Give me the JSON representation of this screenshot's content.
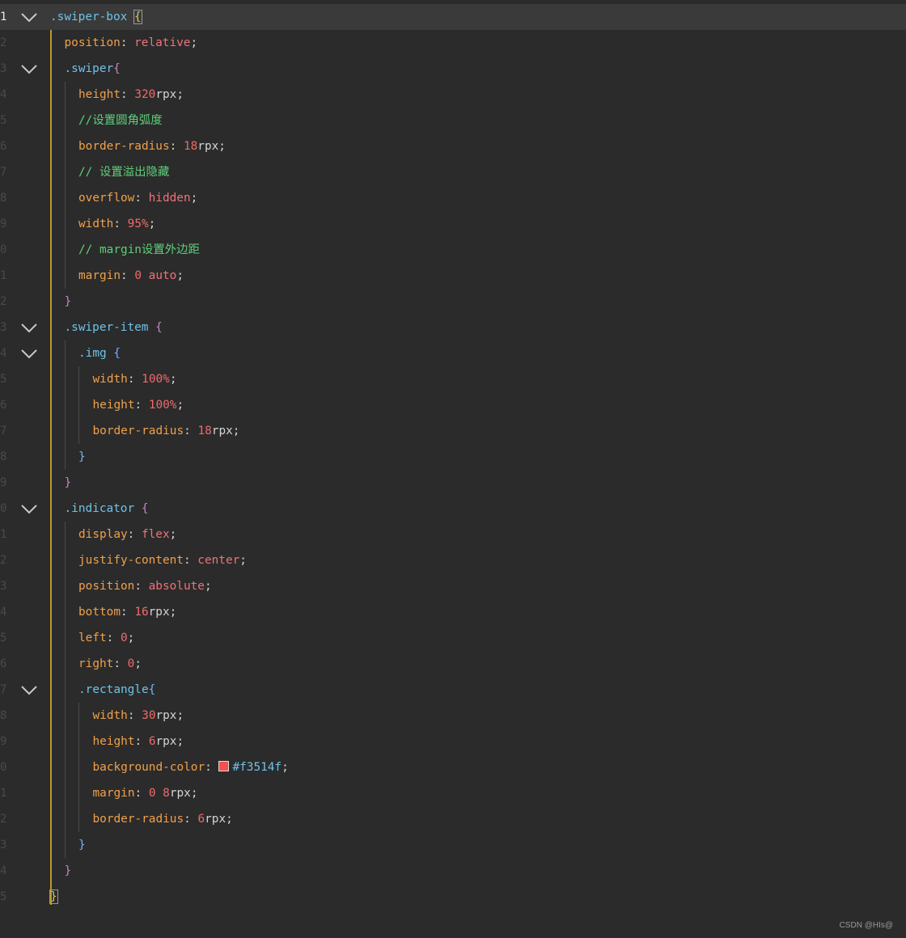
{
  "editor": {
    "colors": {
      "background": "#2b2b2b",
      "current_line": "#3a3a3a",
      "selector": "#6fc3e8",
      "property": "#f0a04b",
      "value": "#f0727a",
      "comment": "#5fce7a"
    },
    "lines": [
      {
        "num": "1",
        "fold": true,
        "current": true,
        "indent": 0,
        "tokens": [
          {
            "t": ".swiper-box",
            "c": "sel"
          },
          {
            "t": " ",
            "c": "punc"
          },
          {
            "t": "{",
            "c": "brace-y brace-box"
          }
        ]
      },
      {
        "num": "2",
        "fold": false,
        "indent": 1,
        "tokens": [
          {
            "t": "position",
            "c": "prop"
          },
          {
            "t": ": ",
            "c": "punc"
          },
          {
            "t": "relative",
            "c": "val"
          },
          {
            "t": ";",
            "c": "punc"
          }
        ]
      },
      {
        "num": "3",
        "fold": true,
        "indent": 1,
        "tokens": [
          {
            "t": ".swiper",
            "c": "sel"
          },
          {
            "t": "{",
            "c": "brace-p"
          }
        ]
      },
      {
        "num": "4",
        "fold": false,
        "indent": 2,
        "tokens": [
          {
            "t": "height",
            "c": "prop"
          },
          {
            "t": ": ",
            "c": "punc"
          },
          {
            "t": "320",
            "c": "num"
          },
          {
            "t": "rpx",
            "c": "unit"
          },
          {
            "t": ";",
            "c": "punc"
          }
        ]
      },
      {
        "num": "5",
        "fold": false,
        "indent": 2,
        "tokens": [
          {
            "t": "//设置圆角弧度",
            "c": "comment"
          }
        ]
      },
      {
        "num": "6",
        "fold": false,
        "indent": 2,
        "tokens": [
          {
            "t": "border-radius",
            "c": "prop"
          },
          {
            "t": ": ",
            "c": "punc"
          },
          {
            "t": "18",
            "c": "num"
          },
          {
            "t": "rpx",
            "c": "unit"
          },
          {
            "t": ";",
            "c": "punc"
          }
        ]
      },
      {
        "num": "7",
        "fold": false,
        "indent": 2,
        "tokens": [
          {
            "t": "// 设置溢出隐藏",
            "c": "comment"
          }
        ]
      },
      {
        "num": "8",
        "fold": false,
        "indent": 2,
        "tokens": [
          {
            "t": "overflow",
            "c": "prop"
          },
          {
            "t": ": ",
            "c": "punc"
          },
          {
            "t": "hidden",
            "c": "val"
          },
          {
            "t": ";",
            "c": "punc"
          }
        ]
      },
      {
        "num": "9",
        "fold": false,
        "indent": 2,
        "tokens": [
          {
            "t": "width",
            "c": "prop"
          },
          {
            "t": ": ",
            "c": "punc"
          },
          {
            "t": "95%",
            "c": "num"
          },
          {
            "t": ";",
            "c": "punc"
          }
        ]
      },
      {
        "num": "0",
        "fold": false,
        "indent": 2,
        "tokens": [
          {
            "t": "// margin设置外边距",
            "c": "comment"
          }
        ]
      },
      {
        "num": "1",
        "fold": false,
        "indent": 2,
        "tokens": [
          {
            "t": "margin",
            "c": "prop"
          },
          {
            "t": ": ",
            "c": "punc"
          },
          {
            "t": "0",
            "c": "num"
          },
          {
            "t": " ",
            "c": "punc"
          },
          {
            "t": "auto",
            "c": "val"
          },
          {
            "t": ";",
            "c": "punc"
          }
        ]
      },
      {
        "num": "2",
        "fold": false,
        "indent": 1,
        "tokens": [
          {
            "t": "}",
            "c": "brace-p"
          }
        ]
      },
      {
        "num": "3",
        "fold": true,
        "indent": 1,
        "tokens": [
          {
            "t": ".swiper-item",
            "c": "sel"
          },
          {
            "t": " ",
            "c": "punc"
          },
          {
            "t": "{",
            "c": "brace-p"
          }
        ]
      },
      {
        "num": "4",
        "fold": true,
        "indent": 2,
        "tokens": [
          {
            "t": ".img",
            "c": "sel"
          },
          {
            "t": " ",
            "c": "punc"
          },
          {
            "t": "{",
            "c": "brace-b"
          }
        ]
      },
      {
        "num": "5",
        "fold": false,
        "indent": 3,
        "tokens": [
          {
            "t": "width",
            "c": "prop"
          },
          {
            "t": ": ",
            "c": "punc"
          },
          {
            "t": "100%",
            "c": "num"
          },
          {
            "t": ";",
            "c": "punc"
          }
        ]
      },
      {
        "num": "6",
        "fold": false,
        "indent": 3,
        "tokens": [
          {
            "t": "height",
            "c": "prop"
          },
          {
            "t": ": ",
            "c": "punc"
          },
          {
            "t": "100%",
            "c": "num"
          },
          {
            "t": ";",
            "c": "punc"
          }
        ]
      },
      {
        "num": "7",
        "fold": false,
        "indent": 3,
        "tokens": [
          {
            "t": "border-radius",
            "c": "prop"
          },
          {
            "t": ": ",
            "c": "punc"
          },
          {
            "t": "18",
            "c": "num"
          },
          {
            "t": "rpx",
            "c": "unit"
          },
          {
            "t": ";",
            "c": "punc"
          }
        ]
      },
      {
        "num": "8",
        "fold": false,
        "indent": 2,
        "tokens": [
          {
            "t": "}",
            "c": "brace-b"
          }
        ]
      },
      {
        "num": "9",
        "fold": false,
        "indent": 1,
        "tokens": [
          {
            "t": "}",
            "c": "brace-p"
          }
        ]
      },
      {
        "num": "0",
        "fold": true,
        "indent": 1,
        "tokens": [
          {
            "t": ".indicator",
            "c": "sel"
          },
          {
            "t": " ",
            "c": "punc"
          },
          {
            "t": "{",
            "c": "brace-p"
          }
        ]
      },
      {
        "num": "1",
        "fold": false,
        "indent": 2,
        "tokens": [
          {
            "t": "display",
            "c": "prop"
          },
          {
            "t": ": ",
            "c": "punc"
          },
          {
            "t": "flex",
            "c": "val"
          },
          {
            "t": ";",
            "c": "punc"
          }
        ]
      },
      {
        "num": "2",
        "fold": false,
        "indent": 2,
        "tokens": [
          {
            "t": "justify-content",
            "c": "prop"
          },
          {
            "t": ": ",
            "c": "punc"
          },
          {
            "t": "center",
            "c": "val"
          },
          {
            "t": ";",
            "c": "punc"
          }
        ]
      },
      {
        "num": "3",
        "fold": false,
        "indent": 2,
        "tokens": [
          {
            "t": "position",
            "c": "prop"
          },
          {
            "t": ": ",
            "c": "punc"
          },
          {
            "t": "absolute",
            "c": "val"
          },
          {
            "t": ";",
            "c": "punc"
          }
        ]
      },
      {
        "num": "4",
        "fold": false,
        "indent": 2,
        "tokens": [
          {
            "t": "bottom",
            "c": "prop"
          },
          {
            "t": ": ",
            "c": "punc"
          },
          {
            "t": "16",
            "c": "num"
          },
          {
            "t": "rpx",
            "c": "unit"
          },
          {
            "t": ";",
            "c": "punc"
          }
        ]
      },
      {
        "num": "5",
        "fold": false,
        "indent": 2,
        "tokens": [
          {
            "t": "left",
            "c": "prop"
          },
          {
            "t": ": ",
            "c": "punc"
          },
          {
            "t": "0",
            "c": "num"
          },
          {
            "t": ";",
            "c": "punc"
          }
        ]
      },
      {
        "num": "6",
        "fold": false,
        "indent": 2,
        "tokens": [
          {
            "t": "right",
            "c": "prop"
          },
          {
            "t": ": ",
            "c": "punc"
          },
          {
            "t": "0",
            "c": "num"
          },
          {
            "t": ";",
            "c": "punc"
          }
        ]
      },
      {
        "num": "7",
        "fold": true,
        "indent": 2,
        "tokens": [
          {
            "t": ".rectangle",
            "c": "sel"
          },
          {
            "t": "{",
            "c": "brace-b"
          }
        ]
      },
      {
        "num": "8",
        "fold": false,
        "indent": 3,
        "tokens": [
          {
            "t": "width",
            "c": "prop"
          },
          {
            "t": ": ",
            "c": "punc"
          },
          {
            "t": "30",
            "c": "num"
          },
          {
            "t": "rpx",
            "c": "unit"
          },
          {
            "t": ";",
            "c": "punc"
          }
        ]
      },
      {
        "num": "9",
        "fold": false,
        "indent": 3,
        "tokens": [
          {
            "t": "height",
            "c": "prop"
          },
          {
            "t": ": ",
            "c": "punc"
          },
          {
            "t": "6",
            "c": "num"
          },
          {
            "t": "rpx",
            "c": "unit"
          },
          {
            "t": ";",
            "c": "punc"
          }
        ]
      },
      {
        "num": "0",
        "fold": false,
        "indent": 3,
        "tokens": [
          {
            "t": "background-color",
            "c": "prop"
          },
          {
            "t": ": ",
            "c": "punc"
          },
          {
            "t": "",
            "c": "swatch",
            "color": "#f3514f"
          },
          {
            "t": "#f3514f",
            "c": "hexval"
          },
          {
            "t": ";",
            "c": "punc"
          }
        ]
      },
      {
        "num": "1",
        "fold": false,
        "indent": 3,
        "tokens": [
          {
            "t": "margin",
            "c": "prop"
          },
          {
            "t": ": ",
            "c": "punc"
          },
          {
            "t": "0",
            "c": "num"
          },
          {
            "t": " ",
            "c": "punc"
          },
          {
            "t": "8",
            "c": "num"
          },
          {
            "t": "rpx",
            "c": "unit"
          },
          {
            "t": ";",
            "c": "punc"
          }
        ]
      },
      {
        "num": "2",
        "fold": false,
        "indent": 3,
        "tokens": [
          {
            "t": "border-radius",
            "c": "prop"
          },
          {
            "t": ": ",
            "c": "punc"
          },
          {
            "t": "6",
            "c": "num"
          },
          {
            "t": "rpx",
            "c": "unit"
          },
          {
            "t": ";",
            "c": "punc"
          }
        ]
      },
      {
        "num": "3",
        "fold": false,
        "indent": 2,
        "tokens": [
          {
            "t": "}",
            "c": "brace-b"
          }
        ]
      },
      {
        "num": "4",
        "fold": false,
        "indent": 1,
        "tokens": [
          {
            "t": "}",
            "c": "brace-p"
          }
        ]
      },
      {
        "num": "5",
        "fold": false,
        "indent": 0,
        "tokens": [
          {
            "t": "}",
            "c": "brace-y brace-box"
          }
        ]
      }
    ]
  },
  "watermark": "CSDN @HIs@"
}
